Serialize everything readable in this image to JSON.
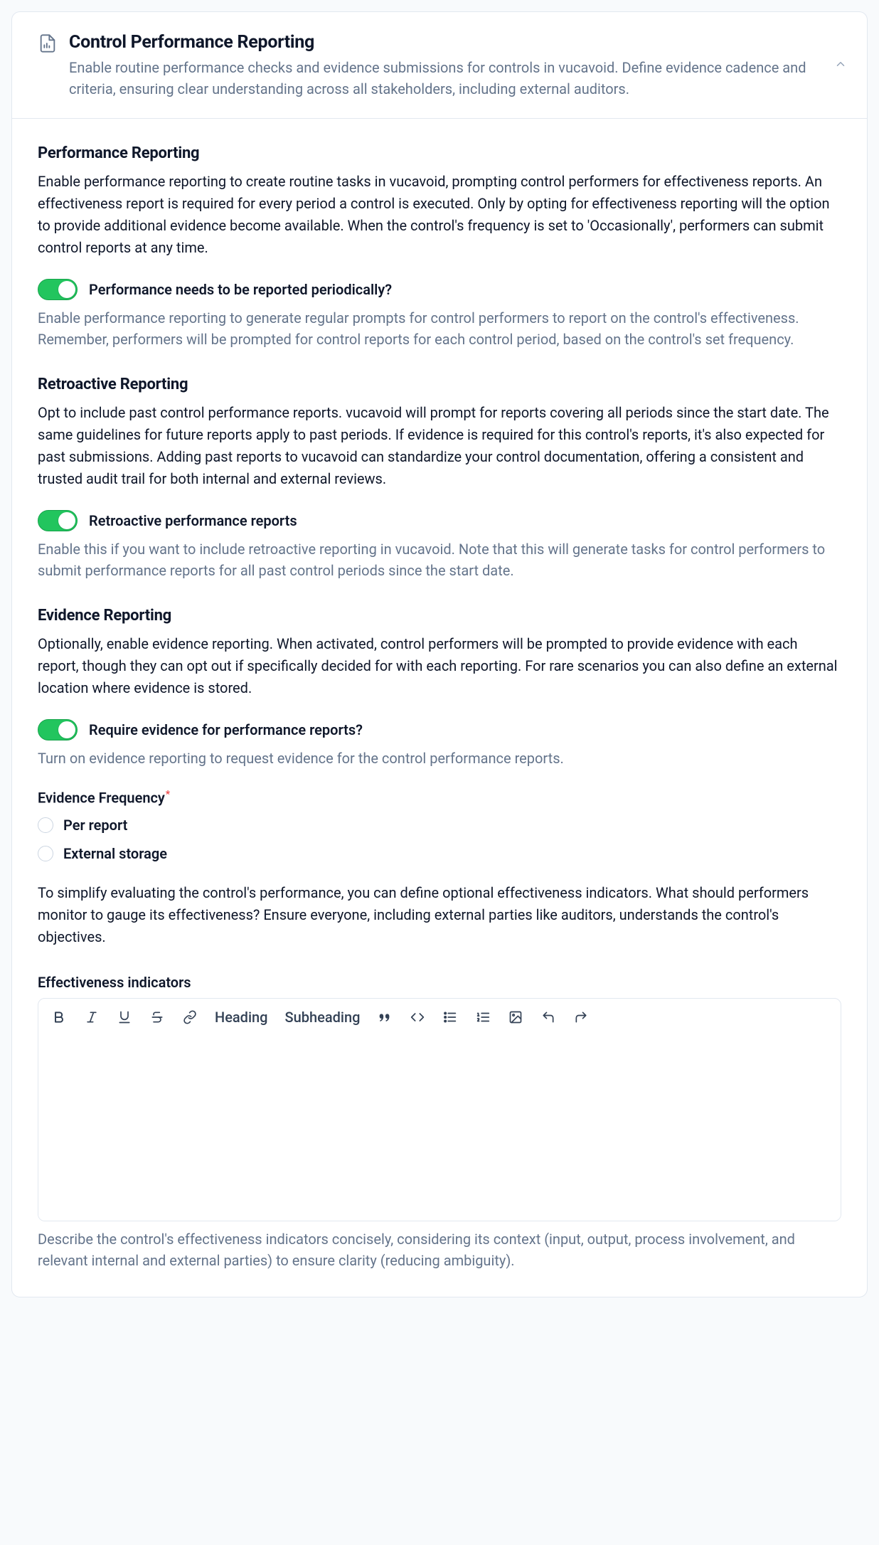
{
  "header": {
    "title": "Control Performance Reporting",
    "description": "Enable routine performance checks and evidence submissions for controls in vucavoid. Define evidence cadence and criteria, ensuring clear understanding across all stakeholders, including external auditors."
  },
  "sections": {
    "performance": {
      "title": "Performance Reporting",
      "desc": "Enable performance reporting to create routine tasks in vucavoid, prompting control performers for effectiveness reports. An effectiveness report is required for every period a control is executed. Only by opting for effectiveness reporting will the option to provide additional evidence become available. When the control's frequency is set to 'Occasionally', performers can submit control reports at any time.",
      "toggle_label": "Performance needs to be reported periodically?",
      "help": "Enable performance reporting to generate regular prompts for control performers to report on the control's effectiveness. Remember, performers will be prompted for control reports for each control period, based on the control's set frequency."
    },
    "retroactive": {
      "title": "Retroactive Reporting",
      "desc": "Opt to include past control performance reports. vucavoid will prompt for reports covering all periods since the start date. The same guidelines for future reports apply to past periods. If evidence is required for this control's reports, it's also expected for past submissions. Adding past reports to vucavoid can standardize your control documentation, offering a consistent and trusted audit trail for both internal and external reviews.",
      "toggle_label": "Retroactive performance reports",
      "help": "Enable this if you want to include retroactive reporting in vucavoid. Note that this will generate tasks for control performers to submit performance reports for all past control periods since the start date."
    },
    "evidence": {
      "title": "Evidence Reporting",
      "desc": "Optionally, enable evidence reporting. When activated, control performers will be prompted to provide evidence with each report, though they can opt out if specifically decided for with each reporting. For rare scenarios you can also define an external location where evidence is stored.",
      "toggle_label": "Require evidence for performance reports?",
      "help": "Turn on evidence reporting to request evidence for the control performance reports."
    }
  },
  "evidence_frequency": {
    "label": "Evidence Frequency",
    "required_marker": "*",
    "options": {
      "per_report": "Per report",
      "external": "External storage"
    }
  },
  "indicators": {
    "intro": "To simplify evaluating the control's performance, you can define optional effectiveness indicators. What should performers monitor to gauge its effectiveness? Ensure everyone, including external parties like auditors, understands the control's objectives.",
    "label": "Effectiveness indicators",
    "help": "Describe the control's effectiveness indicators concisely, considering its context (input, output, process involvement, and relevant internal and external parties) to ensure clarity (reducing ambiguity)."
  },
  "toolbar": {
    "heading": "Heading",
    "subheading": "Subheading"
  }
}
